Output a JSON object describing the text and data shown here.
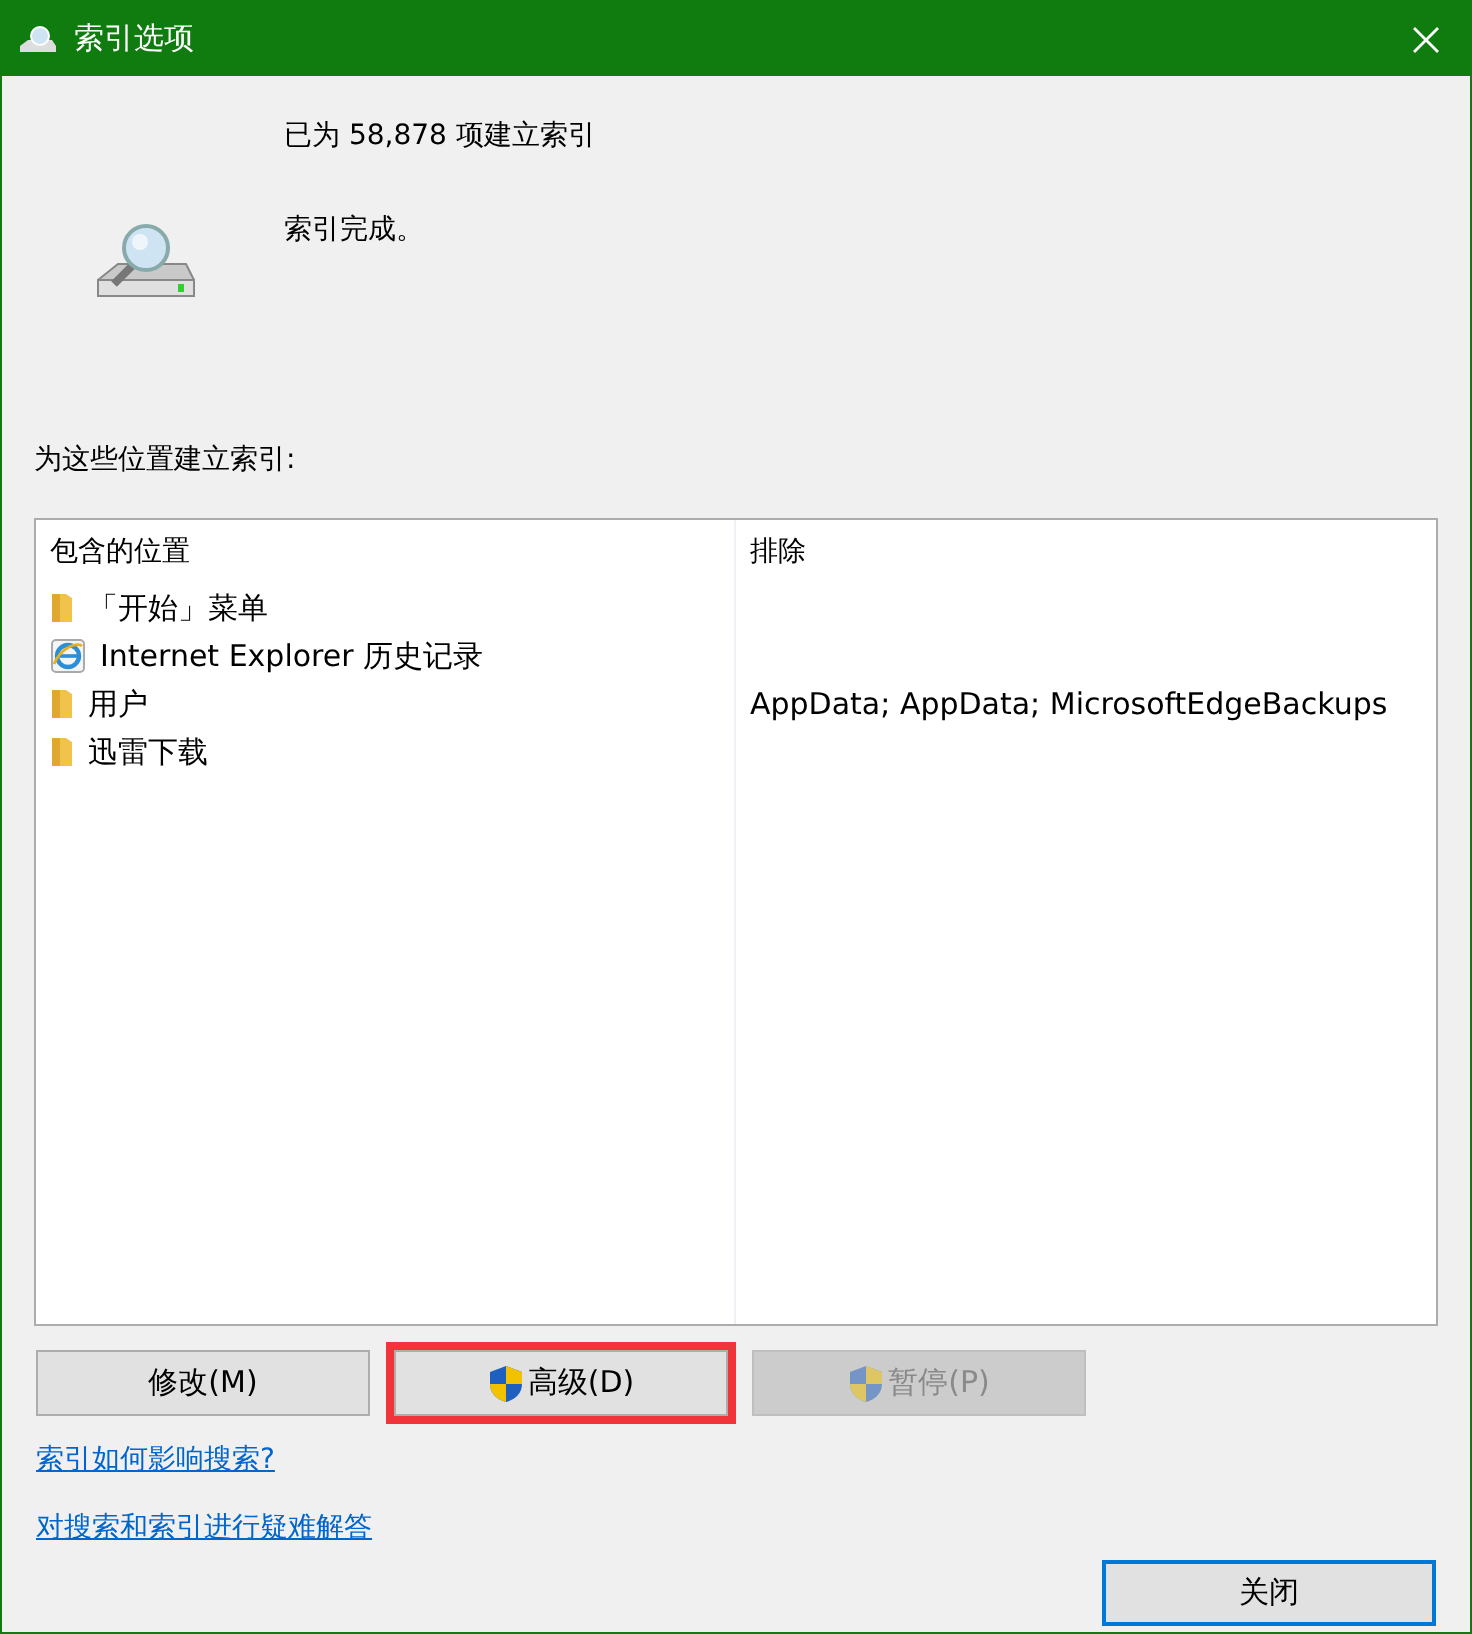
{
  "window": {
    "title": "索引选项"
  },
  "status": {
    "count": "已为 58,878 项建立索引",
    "message": "索引完成。"
  },
  "locations_label": "为这些位置建立索引:",
  "table": {
    "columns": [
      "包含的位置",
      "排除"
    ],
    "rows": [
      {
        "kind": "folder",
        "location": "「开始」菜单",
        "exclude": ""
      },
      {
        "kind": "browser",
        "location": "Internet Explorer 历史记录",
        "exclude": ""
      },
      {
        "kind": "folder",
        "location": "用户",
        "exclude": "AppData; AppData; MicrosoftEdgeBackups"
      },
      {
        "kind": "folder",
        "location": "迅雷下载",
        "exclude": ""
      }
    ]
  },
  "buttons": [
    {
      "label": "修改(M)",
      "shield": false,
      "disabled": false,
      "highlighted": false
    },
    {
      "label": "高级(D)",
      "shield": true,
      "disabled": false,
      "highlighted": true
    },
    {
      "label": "暂停(P)",
      "shield": true,
      "disabled": true,
      "highlighted": false
    }
  ],
  "links": [
    "索引如何影响搜索?",
    "对搜索和索引进行疑难解答"
  ],
  "close_button": {
    "label": "关闭",
    "default": true
  }
}
